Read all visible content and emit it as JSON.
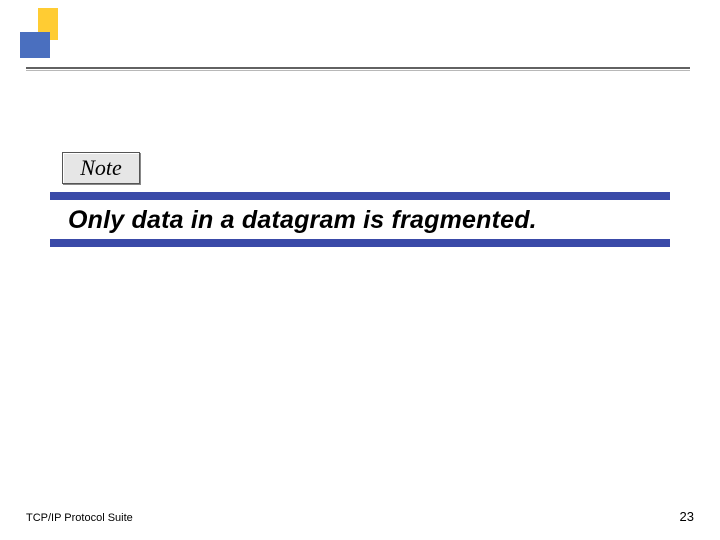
{
  "header": {
    "icon_name": "slide-corner-decoration"
  },
  "note": {
    "label": "Note"
  },
  "callout": {
    "text": "Only data in a datagram is fragmented."
  },
  "footer": {
    "left": "TCP/IP Protocol Suite",
    "page": "23"
  }
}
